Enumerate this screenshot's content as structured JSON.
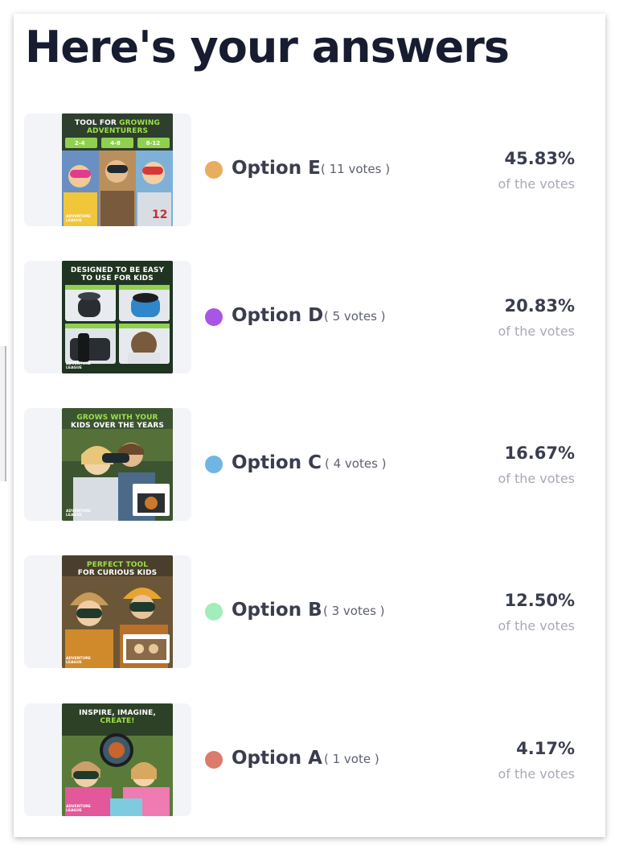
{
  "title": "Here's your answers",
  "results": [
    {
      "option": "Option E",
      "votes": "( 11 votes )",
      "percent": "45.83%",
      "percent_label": "of the votes",
      "dot_color": "#e8ad5e",
      "thumb": {
        "line1": "TOOL FOR",
        "accent": "GROWING",
        "line2": "ADVENTURERS",
        "tags": [
          "2-4",
          "4-8",
          "8-12"
        ],
        "bg": "#2a3d2c"
      }
    },
    {
      "option": "Option D",
      "votes": "( 5 votes )",
      "percent": "20.83%",
      "percent_label": "of the votes",
      "dot_color": "#a855e8",
      "thumb": {
        "line1": "DESIGNED TO BE EASY",
        "accent": "",
        "line2": "TO USE FOR KIDS",
        "bg": "#1f3421"
      }
    },
    {
      "option": "Option C",
      "votes": "( 4 votes )",
      "percent": "16.67%",
      "percent_label": "of the votes",
      "dot_color": "#6fb6e4",
      "thumb": {
        "line1": "GROWS WITH YOUR",
        "accent": "",
        "line2": "KIDS OVER THE YEARS",
        "bg": "#344a2c"
      }
    },
    {
      "option": "Option B",
      "votes": "( 3 votes )",
      "percent": "12.50%",
      "percent_label": "of the votes",
      "dot_color": "#a3ecbb",
      "thumb": {
        "line1": "PERFECT TOOL",
        "accent": "",
        "line2": "FOR CURIOUS KIDS",
        "bg": "#3c3526"
      }
    },
    {
      "option": "Option A",
      "votes": "( 1 vote )",
      "percent": "4.17%",
      "percent_label": "of the votes",
      "dot_color": "#dc7a6c",
      "thumb": {
        "line1": "INSPIRE, IMAGINE,",
        "accent": "",
        "line2": "CREATE!",
        "bg": "#273a22"
      }
    }
  ],
  "logo_text": "ADVENTURE\nLEAGUE"
}
